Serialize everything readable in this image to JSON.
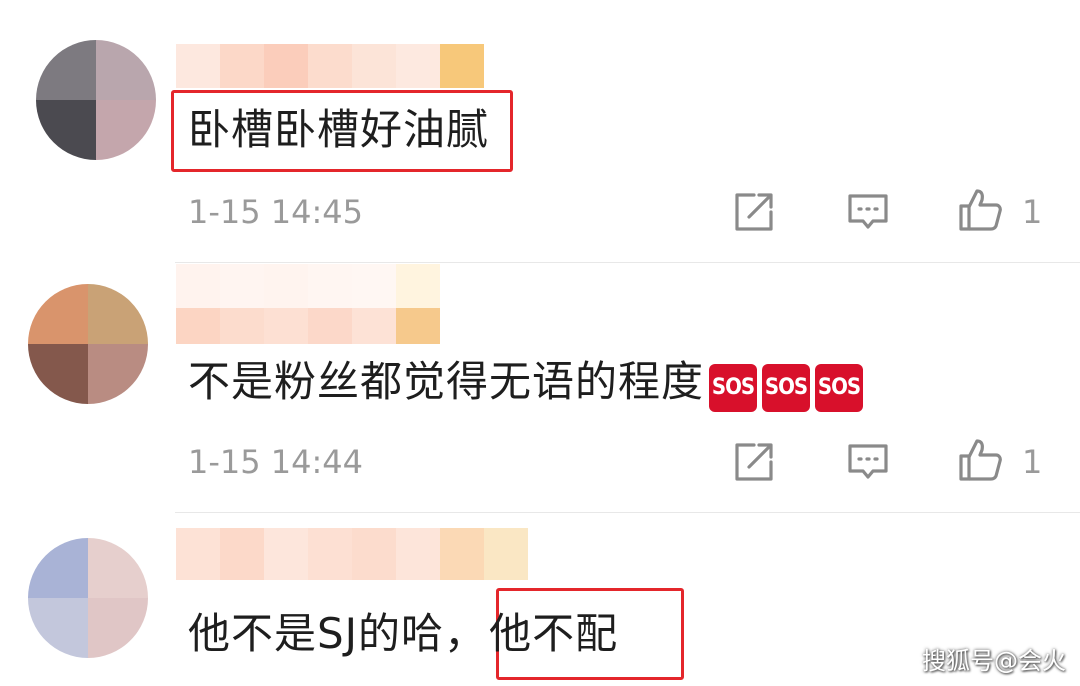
{
  "comments": [
    {
      "text": "卧槽卧槽好油腻",
      "timestamp": "1-15 14:45",
      "like_count": "1",
      "highlighted": true,
      "avatar_colors": [
        "#7d7a80",
        "#b9a6ad",
        "#4b4a50",
        "#c4a6ac"
      ]
    },
    {
      "text": "不是粉丝都觉得无语的程度",
      "emoji": [
        "SOS",
        "SOS",
        "SOS"
      ],
      "timestamp": "1-15 14:44",
      "like_count": "1",
      "highlighted": false,
      "avatar_colors": [
        "#d9946c",
        "#c9a276",
        "#84584c",
        "#b98c82"
      ]
    },
    {
      "text_plain": "他不是SJ的哈，",
      "text_highlighted": "他不配",
      "highlighted": true,
      "avatar_colors": [
        "#a9b3d6",
        "#e6cfcd",
        "#c3c7dc",
        "#e0c6c6"
      ]
    }
  ],
  "icons": {
    "share": "share-icon",
    "reply": "comment-icon",
    "like": "thumbs-up-icon"
  },
  "colors": {
    "highlight_border": "#e4262b",
    "timestamp": "#9a9a9a",
    "sos_badge": "#d8102b"
  },
  "watermark": "搜狐号@会火"
}
